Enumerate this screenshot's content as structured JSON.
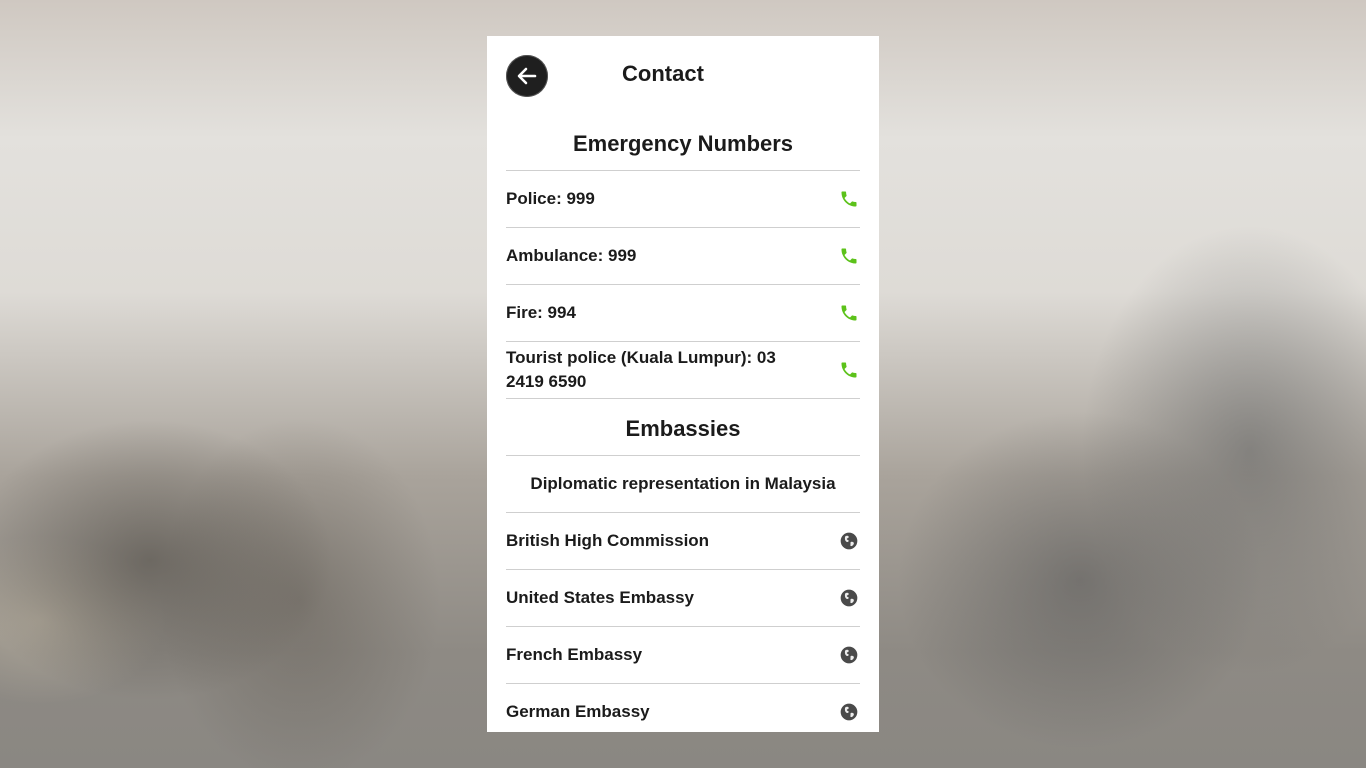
{
  "header": {
    "title": "Contact",
    "back_icon": "arrow-left-icon"
  },
  "emergency": {
    "heading": "Emergency Numbers",
    "items": [
      {
        "label": "Police: 999",
        "icon": "phone-icon"
      },
      {
        "label": "Ambulance: 999",
        "icon": "phone-icon"
      },
      {
        "label": "Fire: 994",
        "icon": "phone-icon"
      },
      {
        "label": "Tourist police (Kuala Lumpur): 03 2419 6590",
        "icon": "phone-icon"
      }
    ]
  },
  "embassies": {
    "heading": "Embassies",
    "subheading": "Diplomatic representation in Malaysia",
    "items": [
      {
        "label": "British High Commission",
        "icon": "globe-icon"
      },
      {
        "label": "United States Embassy",
        "icon": "globe-icon"
      },
      {
        "label": "French Embassy",
        "icon": "globe-icon"
      },
      {
        "label": "German Embassy",
        "icon": "globe-icon"
      }
    ]
  },
  "colors": {
    "phone_icon": "#5cc21a",
    "globe_icon": "#4a4a4a",
    "back_button": "#1f1f1f",
    "divider": "#cfcfcf"
  }
}
